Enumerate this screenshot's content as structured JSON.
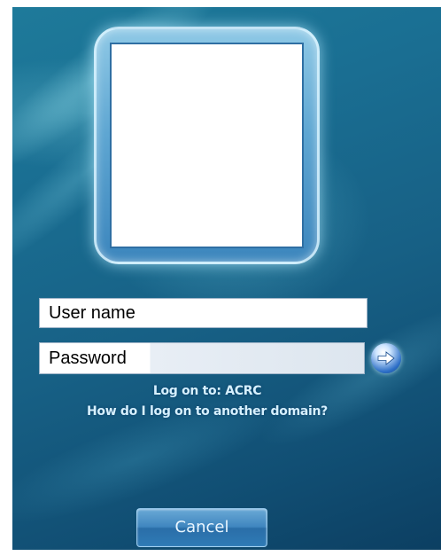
{
  "login": {
    "username_placeholder": "User name",
    "password_placeholder": "Password",
    "logon_to": "Log on to: ACRC",
    "other_domain_link": "How do I log on to another domain?",
    "cancel_label": "Cancel"
  },
  "icons": {
    "submit": "arrow-right-icon",
    "avatar": "user-picture"
  },
  "colors": {
    "background": "#176085",
    "info_text": "#d6f0ff",
    "submit_button": "#2d6fc7"
  }
}
